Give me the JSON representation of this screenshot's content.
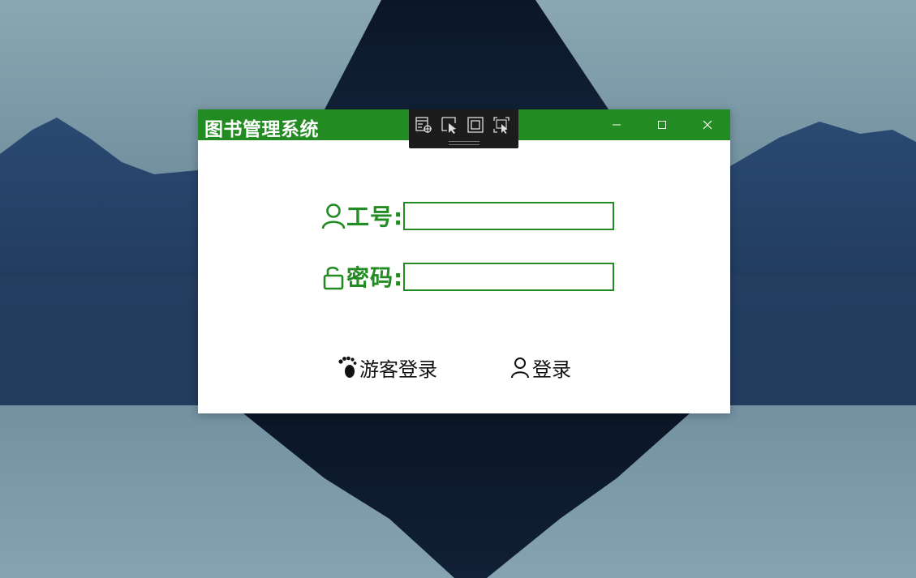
{
  "window": {
    "title": "图书管理系统",
    "controls": {
      "minimize": "minimize-icon",
      "maximize": "maximize-icon",
      "close": "close-icon"
    }
  },
  "devtools": {
    "buttons": [
      "live-visual-tree-icon",
      "select-element-icon",
      "display-layout-adorners-icon",
      "track-focused-element-icon"
    ]
  },
  "form": {
    "id_label": "工号:",
    "id_value": "",
    "password_label": "密码:",
    "password_value": ""
  },
  "buttons": {
    "guest_label": "游客登录",
    "login_label": "登录"
  },
  "colors": {
    "accent": "#228b22",
    "titlebar_text": "#ffffff",
    "devbar": "#1c1c1c"
  }
}
